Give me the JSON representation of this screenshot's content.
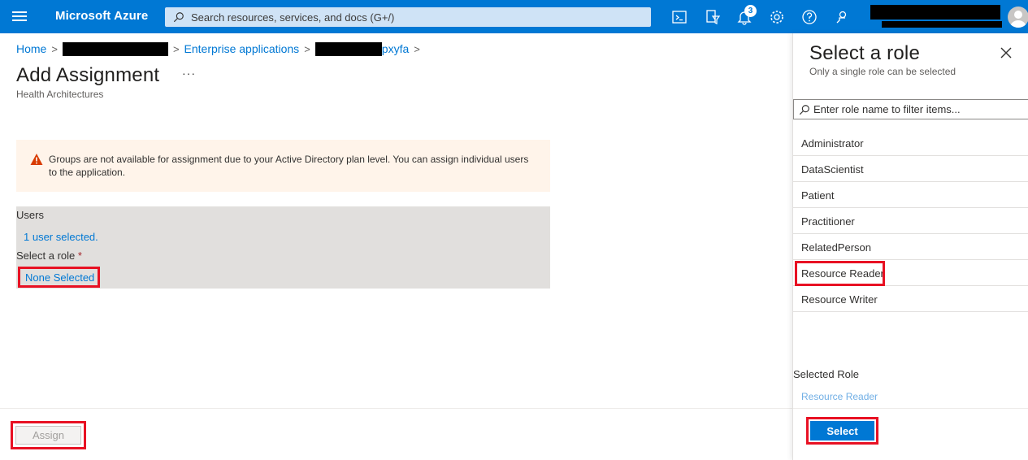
{
  "topbar": {
    "brand": "Microsoft Azure",
    "search_placeholder": "Search resources, services, and docs (G+/)",
    "notification_count": "3"
  },
  "breadcrumb": {
    "home": "Home",
    "enterprise_apps": "Enterprise applications",
    "app_suffix": "pxyfa"
  },
  "page": {
    "title": "Add Assignment",
    "more": "···",
    "subtitle": "Health Architectures"
  },
  "warning": {
    "text": "Groups are not available for assignment due to your Active Directory plan level. You can assign individual users to the application."
  },
  "form": {
    "users_label": "Users",
    "users_value": "1 user selected.",
    "role_label": "Select a role",
    "required_mark": "*",
    "role_value": "None Selected"
  },
  "footer": {
    "assign_label": "Assign"
  },
  "side_panel": {
    "title": "Select a role",
    "subtitle": "Only a single role can be selected",
    "filter_placeholder": "Enter role name to filter items...",
    "roles": [
      {
        "label": "Administrator"
      },
      {
        "label": "DataScientist"
      },
      {
        "label": "Patient"
      },
      {
        "label": "Practitioner"
      },
      {
        "label": "RelatedPerson"
      },
      {
        "label": "Resource Reader"
      },
      {
        "label": "Resource Writer"
      }
    ],
    "selected_role_label": "Selected Role",
    "selected_role_value": "Resource Reader",
    "select_button": "Select"
  },
  "colors": {
    "azure_blue": "#0078d4",
    "highlight_red": "#e81123",
    "warning_bg": "#fff4ea",
    "warning_icon": "#d83b01"
  },
  "icons": [
    "hamburger-icon",
    "search-icon",
    "cloud-shell-icon",
    "directory-filter-icon",
    "bell-icon",
    "gear-icon",
    "help-icon",
    "feedback-icon",
    "avatar-icon",
    "warning-icon",
    "close-icon"
  ]
}
